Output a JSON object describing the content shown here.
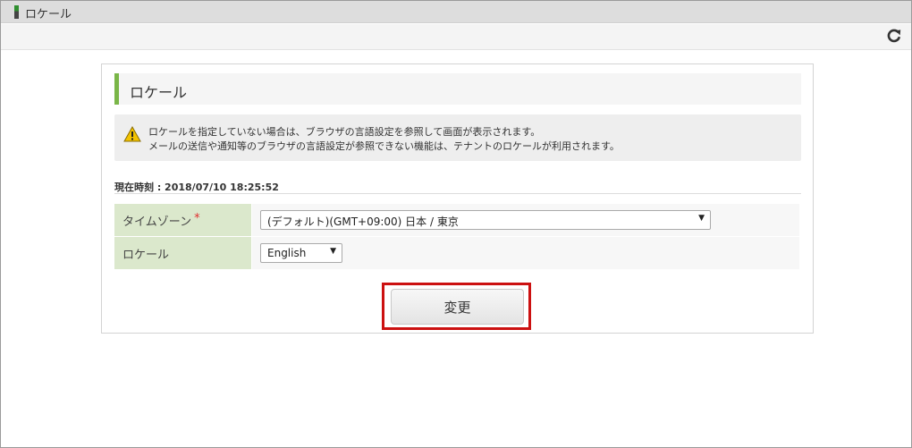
{
  "window": {
    "title": "ロケール"
  },
  "toolbar": {
    "refresh_icon": "refresh-icon"
  },
  "panel": {
    "heading": "ロケール",
    "notice": {
      "icon": "warning-icon",
      "line1": "ロケールを指定していない場合は、ブラウザの言語設定を参照して画面が表示されます。",
      "line2": "メールの送信や通知等のブラウザの言語設定が参照できない機能は、テナントのロケールが利用されます。"
    },
    "current_time": "現在時刻 : 2018/07/10 18:25:52",
    "fields": {
      "timezone": {
        "label": "タイムゾーン",
        "required_mark": "*",
        "value": "(デフォルト)(GMT+09:00) 日本 / 東京"
      },
      "locale": {
        "label": "ロケール",
        "value": "English"
      }
    },
    "submit_label": "変更"
  },
  "colors": {
    "accent": "#7ab648",
    "label_bg": "#dbe8cc",
    "required": "#e03030",
    "highlight": "#cc1111"
  }
}
